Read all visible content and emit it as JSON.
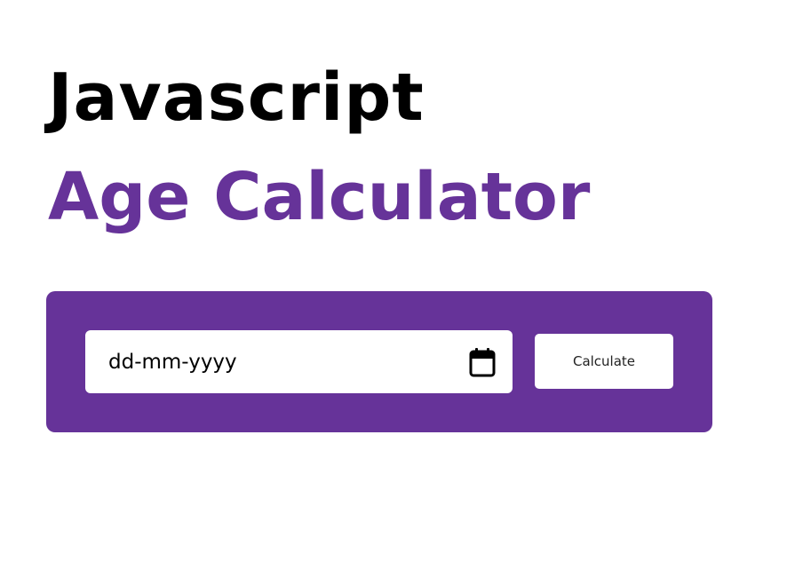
{
  "header": {
    "title_line_1": "Javascript",
    "title_line_2": "Age Calculator"
  },
  "form": {
    "date_placeholder": "dd-mm-yyyy",
    "date_value": "",
    "calendar_icon": "calendar-icon",
    "button_label": "Calculate"
  },
  "colors": {
    "accent": "#663399",
    "title": "#000000",
    "background": "#ffffff"
  }
}
